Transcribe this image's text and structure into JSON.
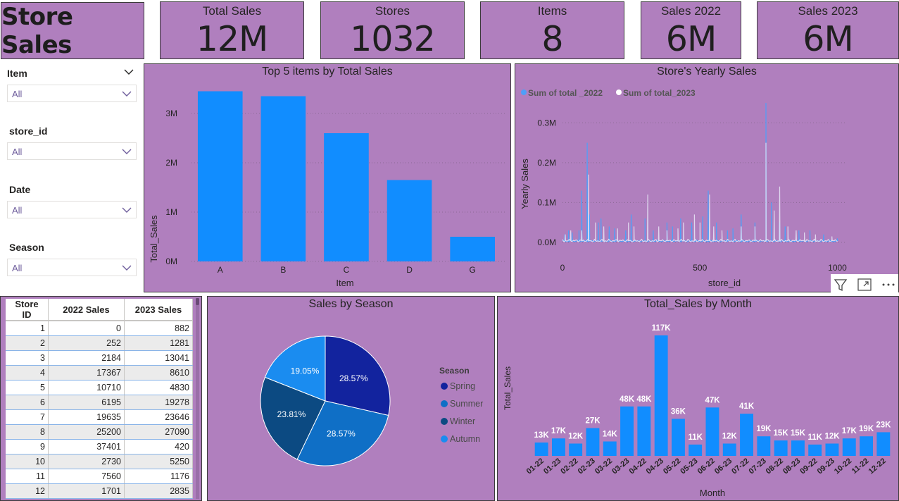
{
  "report_title": "Store Sales",
  "kpis": [
    {
      "label": "Total Sales",
      "value": "12M"
    },
    {
      "label": "Stores",
      "value": "1032"
    },
    {
      "label": "Items",
      "value": "8"
    },
    {
      "label": "Sales 2022",
      "value": "6M"
    },
    {
      "label": "Sales 2023",
      "value": "6M"
    }
  ],
  "slicers": [
    {
      "title": "Item",
      "value": "All"
    },
    {
      "title": "store_id",
      "value": "All"
    },
    {
      "title": "Date",
      "value": "All"
    },
    {
      "title": "Season",
      "value": "All"
    }
  ],
  "colors": {
    "panel_bg": "#b07fbe",
    "bar_blue": "#118dff",
    "pie_spring": "#12239e",
    "pie_summer": "#0f6fc6",
    "pie_winter": "#0c4a82",
    "pie_autumn": "#1a8cf0",
    "line_2022": "#4f9ff8",
    "line_2023": "#e8e8f8"
  },
  "top5": {
    "title": "Top 5 items by Total Sales",
    "xlabel": "Item",
    "ylabel": "Total_Sales",
    "yticks": [
      "0M",
      "1M",
      "2M",
      "3M"
    ]
  },
  "yearly": {
    "title": "Store's Yearly Sales",
    "legend": [
      "Sum of total _2022",
      "Sum of total_2023"
    ],
    "xlabel": "store_id",
    "ylabel": "Yearly Sales",
    "yticks": [
      "0.0M",
      "0.1M",
      "0.2M",
      "0.3M"
    ],
    "xticks": [
      "0",
      "500",
      "1000"
    ]
  },
  "table": {
    "headers": [
      "Store ID",
      "2022 Sales",
      "2023 Sales"
    ],
    "rows": [
      [
        "1",
        "0",
        "882"
      ],
      [
        "2",
        "252",
        "1281"
      ],
      [
        "3",
        "2184",
        "13041"
      ],
      [
        "4",
        "17367",
        "8610"
      ],
      [
        "5",
        "10710",
        "4830"
      ],
      [
        "6",
        "6195",
        "19278"
      ],
      [
        "7",
        "19635",
        "23646"
      ],
      [
        "8",
        "25200",
        "27090"
      ],
      [
        "9",
        "37401",
        "420"
      ],
      [
        "10",
        "2730",
        "5250"
      ],
      [
        "11",
        "7560",
        "1176"
      ],
      [
        "12",
        "1701",
        "2835"
      ]
    ]
  },
  "season": {
    "title": "Sales by Season",
    "legend_title": "Season",
    "legend": [
      "Spring",
      "Summer",
      "Winter",
      "Autumn"
    ]
  },
  "monthly": {
    "title": "Total_Sales by Month",
    "xlabel": "Month",
    "ylabel": "Total_Sales"
  },
  "chart_data": [
    {
      "type": "bar",
      "title": "Top 5 items by Total Sales",
      "xlabel": "Item",
      "ylabel": "Total_Sales",
      "categories": [
        "A",
        "B",
        "C",
        "D",
        "G"
      ],
      "values": [
        3.45,
        3.35,
        2.6,
        1.65,
        0.5
      ],
      "units": "M",
      "ylim": [
        0,
        3.5
      ]
    },
    {
      "type": "line",
      "title": "Store's Yearly Sales",
      "xlabel": "store_id",
      "ylabel": "Yearly Sales",
      "xlim": [
        0,
        1032
      ],
      "ylim": [
        0,
        0.35
      ],
      "units": "M",
      "series": [
        {
          "name": "Sum of total _2022",
          "spikes": [
            [
              8,
              0.02
            ],
            [
              22,
              0.03
            ],
            [
              35,
              0.025
            ],
            [
              60,
              0.03
            ],
            [
              70,
              0.13
            ],
            [
              90,
              0.25
            ],
            [
              98,
              0.07
            ],
            [
              130,
              0.05
            ],
            [
              140,
              0.06
            ],
            [
              170,
              0.04
            ],
            [
              190,
              0.035
            ],
            [
              230,
              0.03
            ],
            [
              250,
              0.07
            ],
            [
              300,
              0.06
            ],
            [
              330,
              0.03
            ],
            [
              380,
              0.05
            ],
            [
              400,
              0.04
            ],
            [
              430,
              0.06
            ],
            [
              470,
              0.05
            ],
            [
              510,
              0.065
            ],
            [
              530,
              0.13
            ],
            [
              560,
              0.05
            ],
            [
              600,
              0.03
            ],
            [
              620,
              0.035
            ],
            [
              650,
              0.07
            ],
            [
              700,
              0.05
            ],
            [
              740,
              0.35
            ],
            [
              760,
              0.1
            ],
            [
              790,
              0.05
            ],
            [
              810,
              0.04
            ],
            [
              860,
              0.03
            ],
            [
              900,
              0.03
            ],
            [
              950,
              0.02
            ],
            [
              1000,
              0.01
            ]
          ]
        },
        {
          "name": "Sum of total_2023",
          "spikes": [
            [
              10,
              0.02
            ],
            [
              30,
              0.03
            ],
            [
              70,
              0.03
            ],
            [
              95,
              0.17
            ],
            [
              120,
              0.05
            ],
            [
              150,
              0.04
            ],
            [
              200,
              0.035
            ],
            [
              240,
              0.05
            ],
            [
              260,
              0.04
            ],
            [
              310,
              0.12
            ],
            [
              350,
              0.04
            ],
            [
              380,
              0.03
            ],
            [
              420,
              0.035
            ],
            [
              440,
              0.05
            ],
            [
              480,
              0.07
            ],
            [
              500,
              0.05
            ],
            [
              535,
              0.12
            ],
            [
              550,
              0.04
            ],
            [
              580,
              0.03
            ],
            [
              650,
              0.04
            ],
            [
              700,
              0.04
            ],
            [
              740,
              0.25
            ],
            [
              770,
              0.08
            ],
            [
              790,
              0.14
            ],
            [
              820,
              0.04
            ],
            [
              850,
              0.03
            ],
            [
              880,
              0.025
            ],
            [
              920,
              0.02
            ],
            [
              980,
              0.015
            ]
          ]
        }
      ]
    },
    {
      "type": "pie",
      "title": "Sales by Season",
      "categories": [
        "Spring",
        "Summer",
        "Winter",
        "Autumn"
      ],
      "values": [
        28.57,
        28.57,
        23.81,
        19.05
      ],
      "labels": [
        "28.57%",
        "28.57%",
        "23.81%",
        "19.05%"
      ]
    },
    {
      "type": "bar",
      "title": "Total_Sales by Month",
      "xlabel": "Month",
      "ylabel": "Total_Sales",
      "categories": [
        "01-22",
        "01-23",
        "02-22",
        "02-23",
        "03-22",
        "03-23",
        "04-22",
        "04-23",
        "05-22",
        "05-23",
        "06-22",
        "06-23",
        "07-22",
        "07-23",
        "08-22",
        "08-23",
        "09-22",
        "09-23",
        "10-22",
        "11-22",
        "12-22"
      ],
      "values": [
        13,
        17,
        12,
        27,
        14,
        48,
        48,
        117,
        36,
        11,
        47,
        12,
        41,
        19,
        15,
        15,
        11,
        12,
        17,
        19,
        23
      ],
      "labels": [
        "13K",
        "17K",
        "12K",
        "27K",
        "14K",
        "48K",
        "48K",
        "117K",
        "36K",
        "11K",
        "47K",
        "12K",
        "41K",
        "19K",
        "15K",
        "15K",
        "11K",
        "12K",
        "17K",
        "19K",
        "23K"
      ],
      "units": "K",
      "ylim": [
        0,
        117
      ]
    }
  ]
}
